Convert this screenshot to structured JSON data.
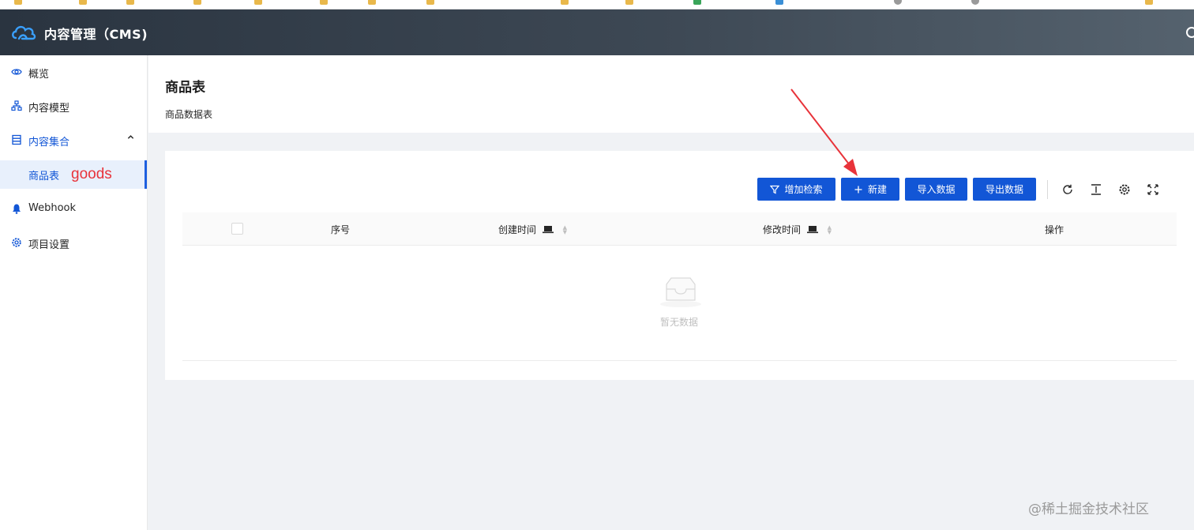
{
  "app": {
    "title": "内容管理（CMS)"
  },
  "sidebar": {
    "items": [
      {
        "label": "概览",
        "icon": "eye-icon"
      },
      {
        "label": "内容模型",
        "icon": "hierarchy-icon"
      },
      {
        "label": "内容集合",
        "icon": "database-icon",
        "expanded": true
      },
      {
        "label": "商品表",
        "selected": true
      },
      {
        "label": "Webhook",
        "icon": "webhook-icon"
      },
      {
        "label": "项目设置",
        "icon": "gear-icon"
      }
    ],
    "annotation": "goods"
  },
  "page": {
    "title": "商品表",
    "subtitle": "商品数据表"
  },
  "toolbar": {
    "filter_label": "增加检索",
    "new_label": "新建",
    "import_label": "导入数据",
    "export_label": "导出数据",
    "icons": [
      "reload-icon",
      "column-height-icon",
      "settings-icon",
      "fullscreen-icon"
    ]
  },
  "table": {
    "columns": [
      "序号",
      "创建时间",
      "修改时间",
      "操作"
    ],
    "rows": [],
    "empty_text": "暂无数据"
  },
  "watermark": {
    "text": "@稀土掘金技术社区"
  },
  "colors": {
    "primary": "#1256d6",
    "header_bg": "#2a3440",
    "annotation_red": "#e8333a",
    "selected_bg": "#e8f0fc"
  }
}
